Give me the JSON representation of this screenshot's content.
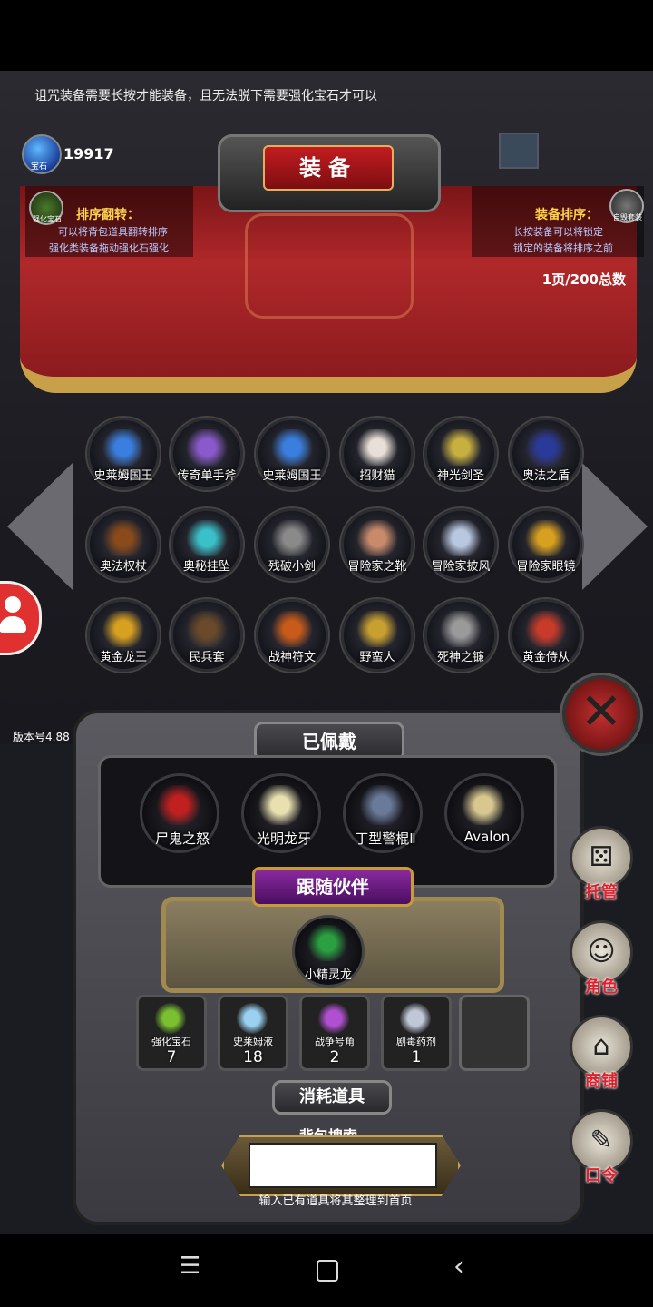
{
  "notice": "诅咒装备需要长按才能装备，且无法脱下需要强化宝石才可以",
  "gem": {
    "icon_label": "宝石",
    "count": "19917"
  },
  "title": "装备",
  "left_panel": {
    "icon_label": "强化宝石",
    "title": "排序翻转：",
    "line1": "可以将背包道具翻转排序",
    "line2": "强化类装备拖动强化石强化"
  },
  "right_panel": {
    "icon_label": "自毁套装",
    "title": "装备排序：",
    "line1": "长按装备可以将锁定",
    "line2": "锁定的装备将排序之前"
  },
  "page_info": "1页/200总数",
  "inventory": [
    {
      "label": "史莱姆国王",
      "color": "#3a7fe0"
    },
    {
      "label": "传奇单手斧",
      "color": "#8a5acc"
    },
    {
      "label": "史莱姆国王",
      "color": "#3a7fe0"
    },
    {
      "label": "招财猫",
      "color": "#e8e0d8"
    },
    {
      "label": "神光剑圣",
      "color": "#c8b040"
    },
    {
      "label": "奥法之盾",
      "color": "#2a3a9a"
    },
    {
      "label": "奥法权杖",
      "color": "#8a4a1a"
    },
    {
      "label": "奥秘挂坠",
      "color": "#3ac0c8"
    },
    {
      "label": "残破小剑",
      "color": "#8a8a8a"
    },
    {
      "label": "冒险家之靴",
      "color": "#c88a6a"
    },
    {
      "label": "冒险家披风",
      "color": "#b8c8e0"
    },
    {
      "label": "冒险家眼镜",
      "color": "#d8a020"
    },
    {
      "label": "黄金龙王",
      "color": "#d8a020"
    },
    {
      "label": "民兵套",
      "color": "#6a4a2a"
    },
    {
      "label": "战神符文",
      "color": "#c85a1a"
    },
    {
      "label": "野蛮人",
      "color": "#c8a030"
    },
    {
      "label": "死神之镰",
      "color": "#9a9a9a"
    },
    {
      "label": "黄金侍从",
      "color": "#c83a2a"
    }
  ],
  "version": "版本号4.88",
  "equipped_title": "已佩戴",
  "equipped": [
    {
      "label": "尸鬼之怒",
      "color": "#c02020"
    },
    {
      "label": "光明龙牙",
      "color": "#e8e0b0"
    },
    {
      "label": "丁型警棍Ⅱ",
      "color": "#6a7a9a"
    },
    {
      "label": "Avalon",
      "color": "#d8c890"
    }
  ],
  "companion_title": "跟随伙伴",
  "companion": {
    "label": "小精灵龙",
    "color": "#2aa040"
  },
  "consumables": [
    {
      "label": "强化宝石",
      "count": "7",
      "color": "#7ac030"
    },
    {
      "label": "史莱姆液",
      "count": "18",
      "color": "#9ad0f0"
    },
    {
      "label": "战争号角",
      "count": "2",
      "color": "#b050d0"
    },
    {
      "label": "剧毒药剂",
      "count": "1",
      "color": "#c0c8d8"
    }
  ],
  "consumables_title": "消耗道具",
  "search": {
    "title": "背包搜索",
    "value": "",
    "hint": "输入已有道具将其整理到首页"
  },
  "right_buttons": [
    {
      "label": "托管",
      "glyph": "⚄"
    },
    {
      "label": "角色",
      "glyph": "☺"
    },
    {
      "label": "商铺",
      "glyph": "⌂"
    },
    {
      "label": "口令",
      "glyph": "✎"
    }
  ],
  "colors": {
    "banner_red": "#b0282a",
    "gold": "#c9a04a",
    "accent_red": "#e0202a"
  }
}
